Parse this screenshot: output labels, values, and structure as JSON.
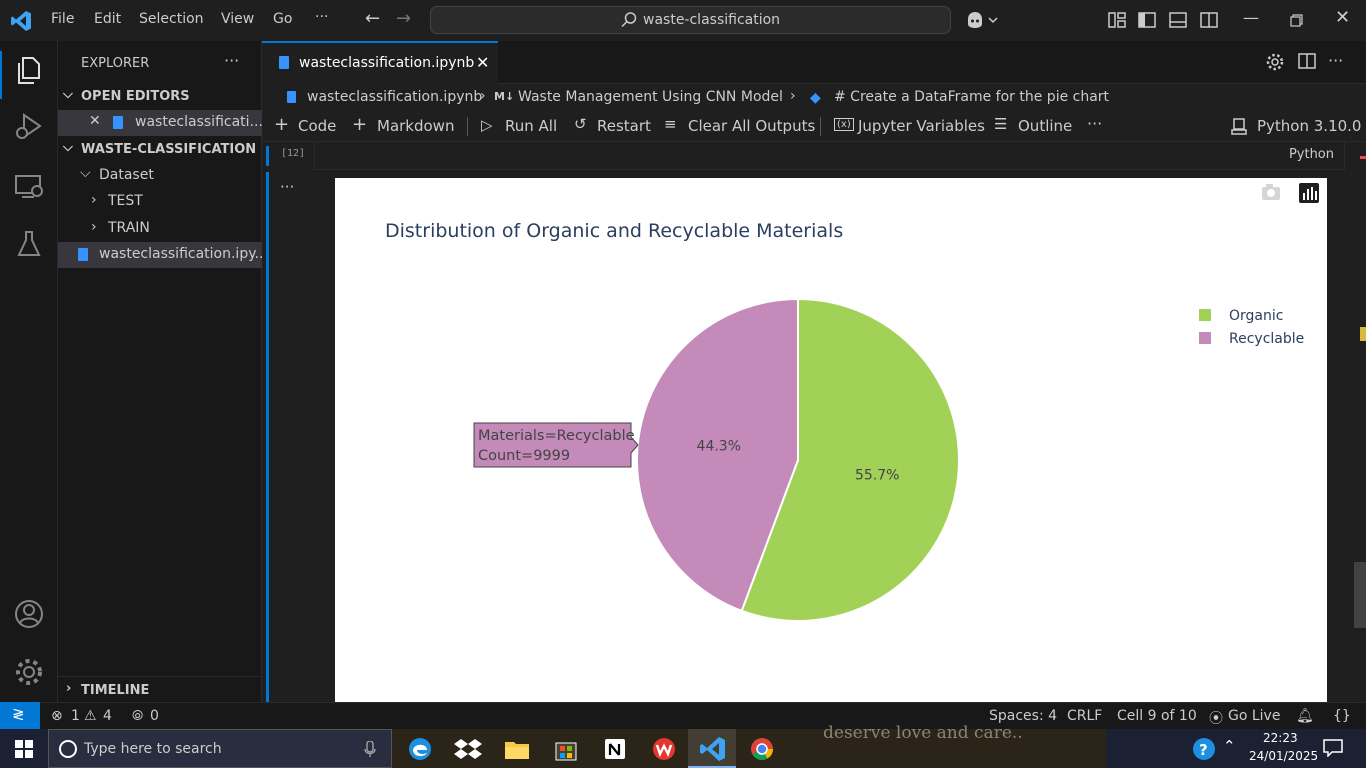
{
  "menu": {
    "items": [
      "File",
      "Edit",
      "Selection",
      "View",
      "Go"
    ],
    "more": "···",
    "search_text": "waste-classification"
  },
  "sidebar": {
    "title": "EXPLORER",
    "open_editors_header": "OPEN EDITORS",
    "open_editor_file": "wasteclassificati...",
    "folder_header": "WASTE-CLASSIFICATION",
    "tree": [
      {
        "label": "Dataset"
      },
      {
        "label": "TEST"
      },
      {
        "label": "TRAIN"
      },
      {
        "label": "wasteclassification.ipy..."
      }
    ],
    "timeline_header": "TIMELINE"
  },
  "tab": {
    "label": "wasteclassification.ipynb"
  },
  "breadcrumbs": {
    "file": "wasteclassification.ipynb",
    "md_prefix": "M↓",
    "section": "Waste Management Using CNN Model",
    "cell": "# Create a DataFrame for the pie chart"
  },
  "toolbar": {
    "code": "Code",
    "markdown": "Markdown",
    "run_all": "Run All",
    "restart": "Restart",
    "clear_outputs": "Clear All Outputs",
    "variables": "Jupyter Variables",
    "outline": "Outline",
    "kernel": "Python 3.10.0"
  },
  "cell": {
    "exec_count": "[12]",
    "language": "Python"
  },
  "chart_data": {
    "type": "pie",
    "title": "Distribution of Organic and Recyclable Materials",
    "labels": [
      "Organic",
      "Recyclable"
    ],
    "percent_labels": [
      "55.7%",
      "44.3%"
    ],
    "values": [
      12565,
      9999
    ],
    "colors": [
      "#a2d158",
      "#c38aba"
    ],
    "legend_position": "top-right",
    "hover": {
      "line1": "Materials=Recyclable",
      "line2": "Count=9999"
    }
  },
  "statusbar": {
    "errors": "1",
    "warnings": "4",
    "ports": "0",
    "spaces": "Spaces: 4",
    "eol": "CRLF",
    "cell_pos": "Cell 9 of 10",
    "golive": "Go Live"
  },
  "taskbar": {
    "search_placeholder": "Type here to search",
    "time": "22:23",
    "date": "24/01/2025",
    "bg_text": "deserve love and care.."
  }
}
